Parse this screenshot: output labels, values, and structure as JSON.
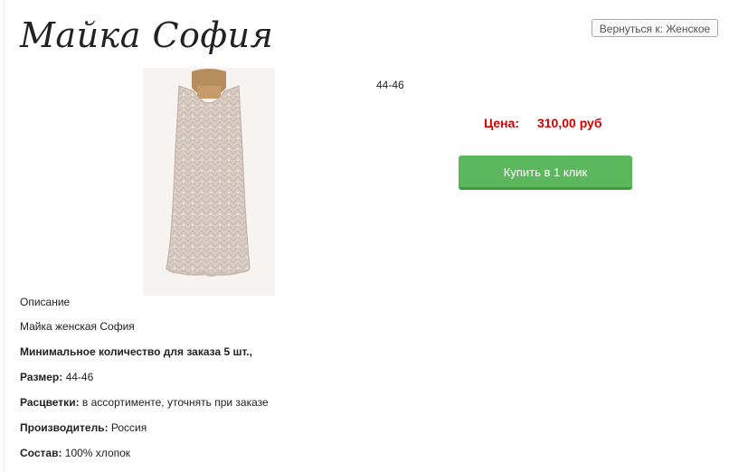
{
  "product": {
    "title": "Майка София",
    "size_badge": "44-46",
    "price_label": "Цена:",
    "price_value": "310,00 руб",
    "buy_button": "Купить в 1 клик"
  },
  "nav": {
    "back_button": "Вернуться к: Женское"
  },
  "description": {
    "heading": "Описание",
    "subtitle": "Майка женская София",
    "min_order": "Минимальное количество для заказа 5 шт.,",
    "rows": [
      {
        "label": "Размер:",
        "value": "44-46"
      },
      {
        "label": "Расцветки:",
        "value": "в ассортименте, уточнять при заказе"
      },
      {
        "label": "Производитель:",
        "value": "Россия"
      },
      {
        "label": "Состав:",
        "value": "100% хлопок"
      }
    ]
  },
  "colors": {
    "price": "#d40000",
    "buy_button": "#5cb85c"
  }
}
